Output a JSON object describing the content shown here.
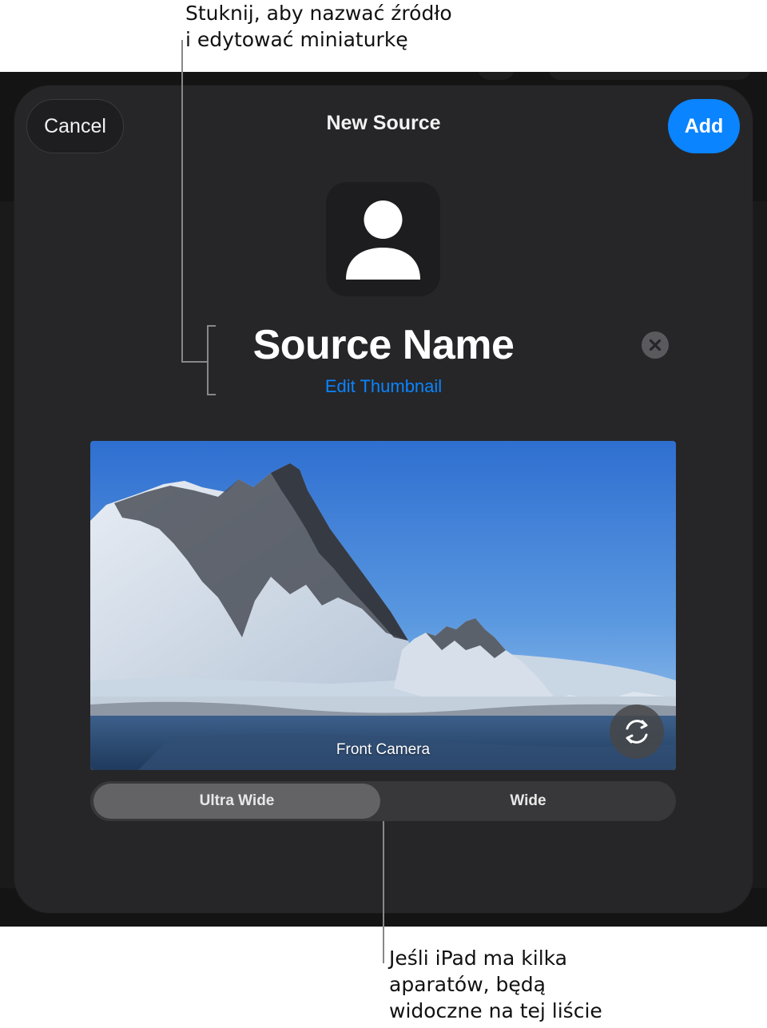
{
  "annotations": {
    "top_callout": [
      "Stuknij, aby nazwać źródło",
      "i edytować miniaturkę"
    ],
    "bottom_callout": [
      "Jeśli iPad ma kilka",
      "aparatów, będą",
      "widoczne na tej liście"
    ]
  },
  "sheet": {
    "title": "New Source",
    "cancel_label": "Cancel",
    "add_label": "Add",
    "source_name": "Source Name",
    "edit_thumbnail_label": "Edit Thumbnail",
    "thumbnail_icon": "person-icon",
    "clear_icon": "xmark-circle-icon"
  },
  "preview": {
    "camera_label": "Front Camera",
    "flip_icon": "camera-rotate-icon"
  },
  "lens_picker": {
    "options": [
      "Ultra Wide",
      "Wide"
    ],
    "selected": "Ultra Wide"
  },
  "colors": {
    "accent": "#0a84ff",
    "sheet_bg": "#262628",
    "segment_selected": "#636366"
  }
}
